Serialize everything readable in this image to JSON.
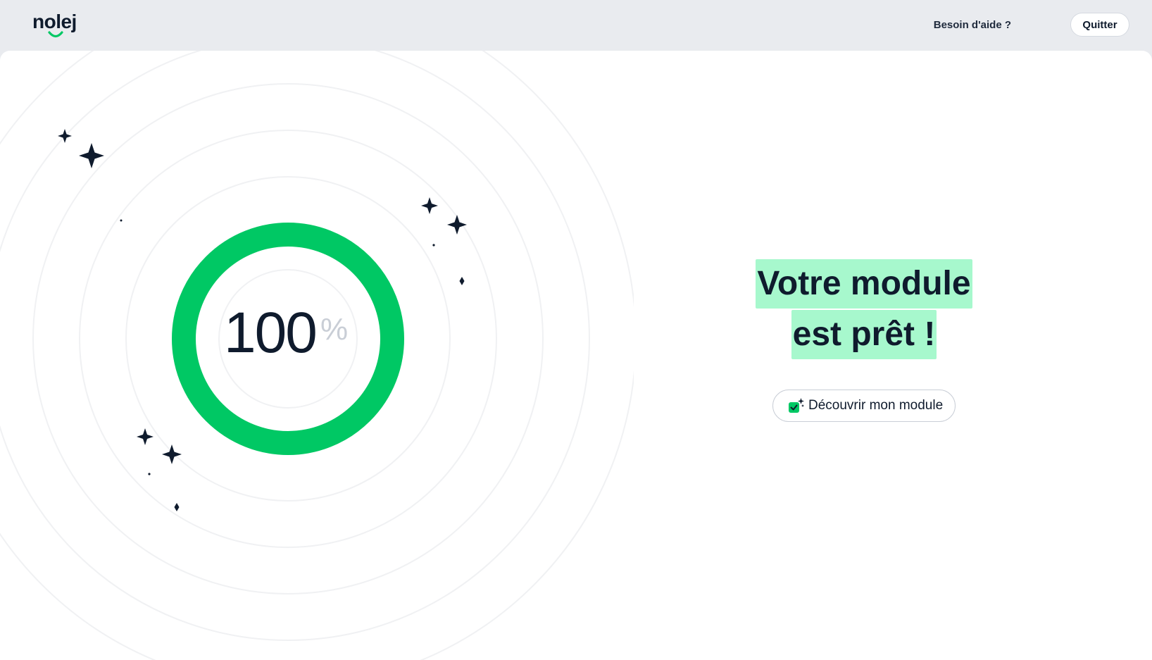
{
  "header": {
    "logo_text": "nolej",
    "help_label": "Besoin d'aide ?",
    "quit_label": "Quitter"
  },
  "progress": {
    "value": "100",
    "unit": "%",
    "fraction": 1.0
  },
  "headline": {
    "line1": "Votre module",
    "line2": "est prêt !"
  },
  "cta": {
    "label": "Découvrir mon module",
    "icon": "sparkle-check-icon"
  },
  "colors": {
    "accent_green": "#00c864",
    "highlight_mint": "#a7f8cd",
    "text_dark": "#0f1b2d",
    "header_bg": "#e9ebef"
  },
  "icons": {
    "logo_mark": "smile-icon",
    "decorations": "star-icon"
  }
}
